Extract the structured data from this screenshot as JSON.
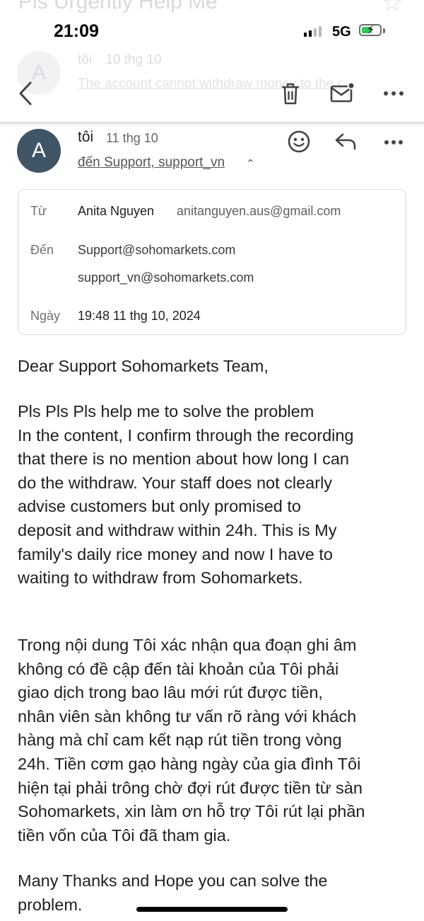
{
  "ghost": {
    "subject": "Pls Urgently Help Me",
    "avatar_letter": "A",
    "sender": "tôi",
    "date": "10 thg 10",
    "snippet": "The account cannot withdraw money to the c"
  },
  "status_bar": {
    "time": "21:09",
    "network": "5G"
  },
  "message": {
    "avatar_letter": "A",
    "avatar_color": "#3f5566",
    "sender": "tôi",
    "date": "11 thg 10",
    "to_summary": "đến Support, support_vn"
  },
  "details": {
    "from_label": "Từ",
    "from_name": "Anita Nguyen",
    "from_email": "anitanguyen.aus@gmail.com",
    "to_label": "Đến",
    "to_1": "Support@sohomarkets.com",
    "to_2": "support_vn@sohomarkets.com",
    "date_label": "Ngày",
    "date_value": "19:48 11 thg 10, 2024"
  },
  "body": {
    "greeting": "Dear Support Sohomarkets Team,",
    "english": "Pls Pls Pls help me to solve the problem\nIn the content, I confirm through the recording\nthat there is no mention about how long I can\ndo the withdraw. Your staff does not clearly\nadvise customers but only promised to\ndeposit and withdraw within 24h. This is My\nfamily's daily rice money and now I have to\nwaiting to withdraw from Sohomarkets.",
    "vietnamese": "Trong nội dung Tôi xác nhận qua đoạn ghi âm\nkhông có đề cập đến tài khoản của Tôi phải\ngiao dịch trong bao lâu mới rút được tiền,\nnhân viên sàn không tư vấn rõ ràng với khách\nhàng mà chỉ cam kết nạp rút tiền trong vòng\n24h. Tiền cơm gạo hàng ngày của gia đình Tôi\nhiện tại phải trông chờ đợi rút được tiền từ sàn\nSohomarkets, xin làm ơn hỗ trợ Tôi rút lại phần\ntiền vốn của Tôi đã tham gia.",
    "closing": "Many Thanks and Hope you can solve the\nproblem."
  }
}
